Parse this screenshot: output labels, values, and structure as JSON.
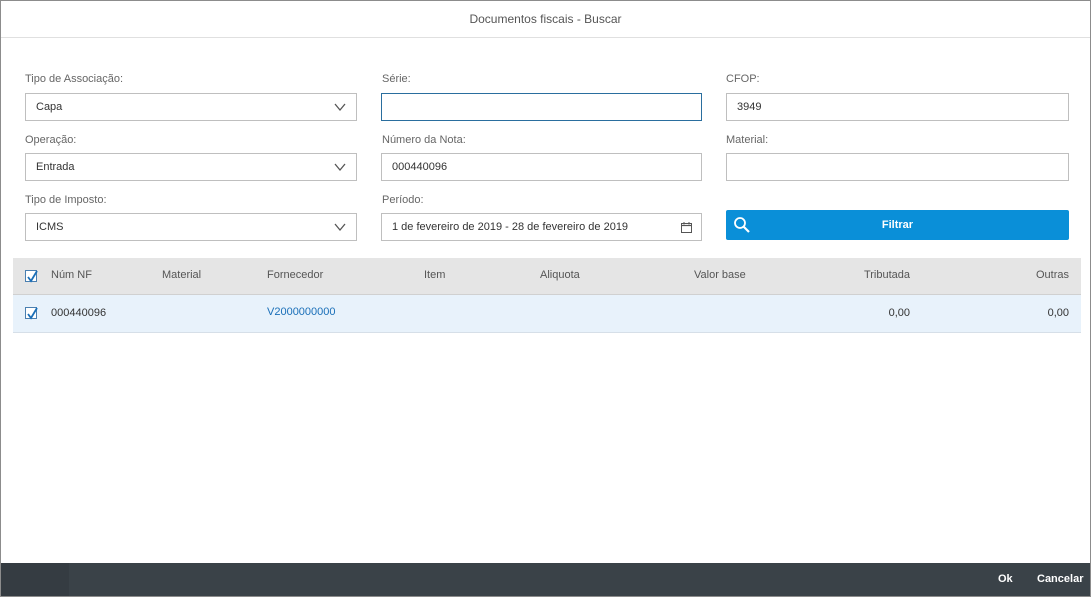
{
  "dialog": {
    "title": "Documentos fiscais - Buscar"
  },
  "form": {
    "tipo_associacao": {
      "label": "Tipo de Associação:",
      "value": "Capa"
    },
    "operacao": {
      "label": "Operação:",
      "value": "Entrada"
    },
    "tipo_imposto": {
      "label": "Tipo de Imposto:",
      "value": "ICMS"
    },
    "serie": {
      "label": "Série:",
      "value": ""
    },
    "numero_nota": {
      "label": "Número da Nota:",
      "value": "000440096"
    },
    "periodo": {
      "label": "Período:",
      "value": "1 de fevereiro de 2019 - 28 de fevereiro de 2019"
    },
    "cfop": {
      "label": "CFOP:",
      "value": "3949"
    },
    "material": {
      "label": "Material:",
      "value": ""
    },
    "filter_button": "Filtrar"
  },
  "table": {
    "columns": [
      "Núm NF",
      "Material",
      "Fornecedor",
      "Item",
      "Aliquota",
      "Valor base",
      "Tributada",
      "Outras"
    ],
    "rows": [
      {
        "num_nf": "000440096",
        "material": "",
        "fornecedor": "V2000000000",
        "item": "",
        "aliquota": "",
        "valor_base": "",
        "tributada": "0,00",
        "outras": "0,00",
        "selected": true
      }
    ]
  },
  "footer": {
    "ok_label": "Ok",
    "cancel_label": "Cancelar"
  },
  "colors": {
    "accent": "#0a8fd8",
    "footer": "#3a4248",
    "link": "#1a6fb8",
    "selected_row": "#e8f2fb"
  }
}
